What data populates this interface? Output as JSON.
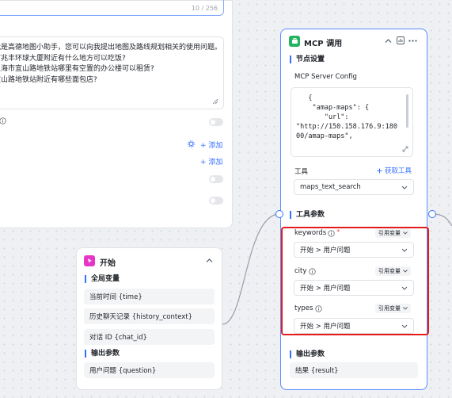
{
  "settings_panel": {
    "char_count": "10 / 256",
    "question_lines": [
      "我是高德地图小助手，您可以向我提出地图及路线规划相关的使用问题。",
      "市兆丰环球大厦附近有什么地方可以吃饭?",
      "上海市宜山路地铁站哪里有空置的办公楼可以租赁?",
      "宜山路地铁站附近有哪些面包店?"
    ],
    "add_label": "+ 添加",
    "toggles": [
      false,
      false,
      false
    ]
  },
  "start_node": {
    "title": "开始",
    "global_vars_label": "全局变量",
    "global_vars": [
      "当前时间 {time}",
      "历史聊天记录 {history_context}",
      "对话 ID {chat_id}"
    ],
    "output_label": "输出参数",
    "outputs": [
      "用户问题 {question}"
    ]
  },
  "mcp_node": {
    "title": "MCP 调用",
    "node_settings_label": "节点设置",
    "server_config_label": "MCP Server Config",
    "config_code": [
      "   {",
      "    \"amap-maps\": {",
      "       \"url\":",
      "\"http://150.158.176.9:180",
      "00/amap-maps\","
    ],
    "tool_label": "工具",
    "fetch_tools_label": "获取工具",
    "tool_value": "maps_text_search",
    "tool_params_label": "工具参数",
    "params": [
      {
        "name": "keywords",
        "required": true,
        "mode": "引用变量",
        "value": "开始 > 用户问题"
      },
      {
        "name": "city",
        "required": false,
        "mode": "引用变量",
        "value": "开始 > 用户问题"
      },
      {
        "name": "types",
        "required": false,
        "mode": "引用变量",
        "value": "开始 > 用户问题"
      }
    ],
    "output_label": "输出参数",
    "outputs": [
      "结果 {result}"
    ]
  },
  "colors": {
    "accent": "#3370ff",
    "start_icon": "#e636c8",
    "mcp_icon": "#22b35e",
    "highlight": "#e31b1b"
  }
}
